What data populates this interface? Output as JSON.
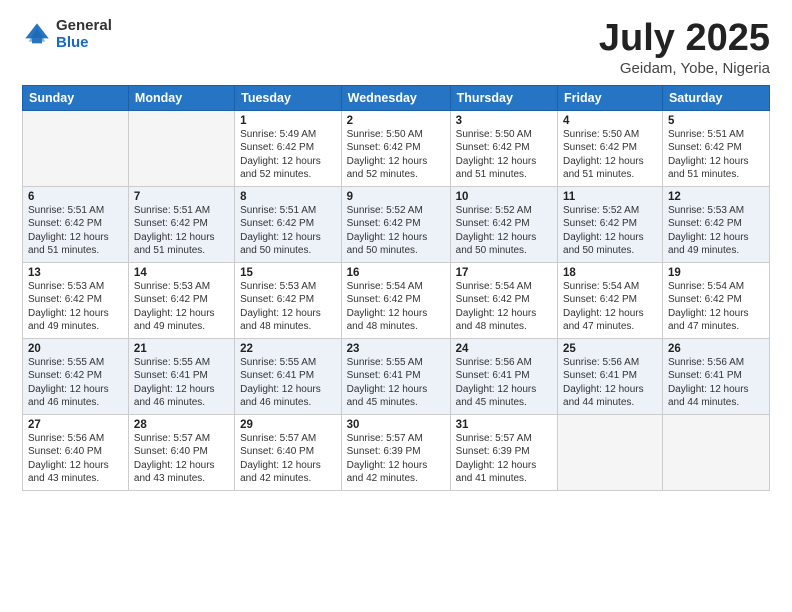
{
  "header": {
    "logo": {
      "line1": "General",
      "line2": "Blue"
    },
    "title": "July 2025",
    "location": "Geidam, Yobe, Nigeria"
  },
  "weekdays": [
    "Sunday",
    "Monday",
    "Tuesday",
    "Wednesday",
    "Thursday",
    "Friday",
    "Saturday"
  ],
  "weeks": [
    [
      {
        "day": "",
        "sunrise": "",
        "sunset": "",
        "daylight": ""
      },
      {
        "day": "",
        "sunrise": "",
        "sunset": "",
        "daylight": ""
      },
      {
        "day": "1",
        "sunrise": "Sunrise: 5:49 AM",
        "sunset": "Sunset: 6:42 PM",
        "daylight": "Daylight: 12 hours and 52 minutes."
      },
      {
        "day": "2",
        "sunrise": "Sunrise: 5:50 AM",
        "sunset": "Sunset: 6:42 PM",
        "daylight": "Daylight: 12 hours and 52 minutes."
      },
      {
        "day": "3",
        "sunrise": "Sunrise: 5:50 AM",
        "sunset": "Sunset: 6:42 PM",
        "daylight": "Daylight: 12 hours and 51 minutes."
      },
      {
        "day": "4",
        "sunrise": "Sunrise: 5:50 AM",
        "sunset": "Sunset: 6:42 PM",
        "daylight": "Daylight: 12 hours and 51 minutes."
      },
      {
        "day": "5",
        "sunrise": "Sunrise: 5:51 AM",
        "sunset": "Sunset: 6:42 PM",
        "daylight": "Daylight: 12 hours and 51 minutes."
      }
    ],
    [
      {
        "day": "6",
        "sunrise": "Sunrise: 5:51 AM",
        "sunset": "Sunset: 6:42 PM",
        "daylight": "Daylight: 12 hours and 51 minutes."
      },
      {
        "day": "7",
        "sunrise": "Sunrise: 5:51 AM",
        "sunset": "Sunset: 6:42 PM",
        "daylight": "Daylight: 12 hours and 51 minutes."
      },
      {
        "day": "8",
        "sunrise": "Sunrise: 5:51 AM",
        "sunset": "Sunset: 6:42 PM",
        "daylight": "Daylight: 12 hours and 50 minutes."
      },
      {
        "day": "9",
        "sunrise": "Sunrise: 5:52 AM",
        "sunset": "Sunset: 6:42 PM",
        "daylight": "Daylight: 12 hours and 50 minutes."
      },
      {
        "day": "10",
        "sunrise": "Sunrise: 5:52 AM",
        "sunset": "Sunset: 6:42 PM",
        "daylight": "Daylight: 12 hours and 50 minutes."
      },
      {
        "day": "11",
        "sunrise": "Sunrise: 5:52 AM",
        "sunset": "Sunset: 6:42 PM",
        "daylight": "Daylight: 12 hours and 50 minutes."
      },
      {
        "day": "12",
        "sunrise": "Sunrise: 5:53 AM",
        "sunset": "Sunset: 6:42 PM",
        "daylight": "Daylight: 12 hours and 49 minutes."
      }
    ],
    [
      {
        "day": "13",
        "sunrise": "Sunrise: 5:53 AM",
        "sunset": "Sunset: 6:42 PM",
        "daylight": "Daylight: 12 hours and 49 minutes."
      },
      {
        "day": "14",
        "sunrise": "Sunrise: 5:53 AM",
        "sunset": "Sunset: 6:42 PM",
        "daylight": "Daylight: 12 hours and 49 minutes."
      },
      {
        "day": "15",
        "sunrise": "Sunrise: 5:53 AM",
        "sunset": "Sunset: 6:42 PM",
        "daylight": "Daylight: 12 hours and 48 minutes."
      },
      {
        "day": "16",
        "sunrise": "Sunrise: 5:54 AM",
        "sunset": "Sunset: 6:42 PM",
        "daylight": "Daylight: 12 hours and 48 minutes."
      },
      {
        "day": "17",
        "sunrise": "Sunrise: 5:54 AM",
        "sunset": "Sunset: 6:42 PM",
        "daylight": "Daylight: 12 hours and 48 minutes."
      },
      {
        "day": "18",
        "sunrise": "Sunrise: 5:54 AM",
        "sunset": "Sunset: 6:42 PM",
        "daylight": "Daylight: 12 hours and 47 minutes."
      },
      {
        "day": "19",
        "sunrise": "Sunrise: 5:54 AM",
        "sunset": "Sunset: 6:42 PM",
        "daylight": "Daylight: 12 hours and 47 minutes."
      }
    ],
    [
      {
        "day": "20",
        "sunrise": "Sunrise: 5:55 AM",
        "sunset": "Sunset: 6:42 PM",
        "daylight": "Daylight: 12 hours and 46 minutes."
      },
      {
        "day": "21",
        "sunrise": "Sunrise: 5:55 AM",
        "sunset": "Sunset: 6:41 PM",
        "daylight": "Daylight: 12 hours and 46 minutes."
      },
      {
        "day": "22",
        "sunrise": "Sunrise: 5:55 AM",
        "sunset": "Sunset: 6:41 PM",
        "daylight": "Daylight: 12 hours and 46 minutes."
      },
      {
        "day": "23",
        "sunrise": "Sunrise: 5:55 AM",
        "sunset": "Sunset: 6:41 PM",
        "daylight": "Daylight: 12 hours and 45 minutes."
      },
      {
        "day": "24",
        "sunrise": "Sunrise: 5:56 AM",
        "sunset": "Sunset: 6:41 PM",
        "daylight": "Daylight: 12 hours and 45 minutes."
      },
      {
        "day": "25",
        "sunrise": "Sunrise: 5:56 AM",
        "sunset": "Sunset: 6:41 PM",
        "daylight": "Daylight: 12 hours and 44 minutes."
      },
      {
        "day": "26",
        "sunrise": "Sunrise: 5:56 AM",
        "sunset": "Sunset: 6:41 PM",
        "daylight": "Daylight: 12 hours and 44 minutes."
      }
    ],
    [
      {
        "day": "27",
        "sunrise": "Sunrise: 5:56 AM",
        "sunset": "Sunset: 6:40 PM",
        "daylight": "Daylight: 12 hours and 43 minutes."
      },
      {
        "day": "28",
        "sunrise": "Sunrise: 5:57 AM",
        "sunset": "Sunset: 6:40 PM",
        "daylight": "Daylight: 12 hours and 43 minutes."
      },
      {
        "day": "29",
        "sunrise": "Sunrise: 5:57 AM",
        "sunset": "Sunset: 6:40 PM",
        "daylight": "Daylight: 12 hours and 42 minutes."
      },
      {
        "day": "30",
        "sunrise": "Sunrise: 5:57 AM",
        "sunset": "Sunset: 6:39 PM",
        "daylight": "Daylight: 12 hours and 42 minutes."
      },
      {
        "day": "31",
        "sunrise": "Sunrise: 5:57 AM",
        "sunset": "Sunset: 6:39 PM",
        "daylight": "Daylight: 12 hours and 41 minutes."
      },
      {
        "day": "",
        "sunrise": "",
        "sunset": "",
        "daylight": ""
      },
      {
        "day": "",
        "sunrise": "",
        "sunset": "",
        "daylight": ""
      }
    ]
  ]
}
